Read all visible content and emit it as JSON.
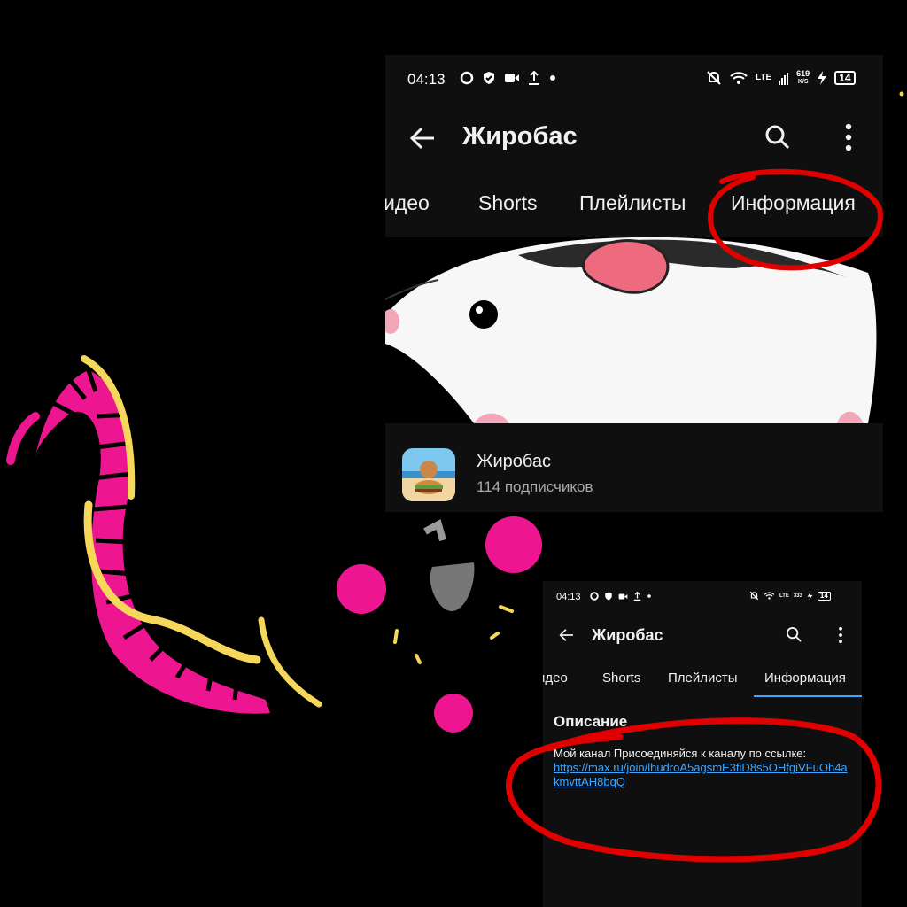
{
  "screenshot_main": {
    "status_bar": {
      "time": "04:13",
      "net_speed_value": "619",
      "net_speed_unit": "K/S",
      "network": "LTE",
      "battery": "14"
    },
    "app_bar": {
      "back_icon": "arrow-left-icon",
      "title": "Жиробас",
      "search_icon": "search-icon",
      "more_icon": "more-vert-icon"
    },
    "tabs": [
      "идео",
      "Shorts",
      "Плейлисты",
      "Информация"
    ],
    "channel": {
      "name": "Жиробас",
      "subscribers": "114 подписчиков"
    }
  },
  "screenshot_inset": {
    "status_bar": {
      "time": "04:13",
      "net_speed_value": "333",
      "network": "LTE",
      "battery": "14"
    },
    "app_bar": {
      "title": "Жиробас"
    },
    "tabs": [
      "идео",
      "Shorts",
      "Плейлисты",
      "Информация"
    ],
    "active_tab": "Информация",
    "description": {
      "heading": "Описание",
      "text": "Мой канал Присоединяйся к каналу по ссылке:",
      "link": "https://max.ru/join/lhudroA5agsmE3fiD8s5OHfgiVFuOh4akmvttAH8bqQ"
    }
  },
  "colors": {
    "annotation_red": "#e00000",
    "worm_pink": "#ee1690",
    "worm_yellow": "#f5d75a",
    "accent": "#3ea6ff"
  }
}
